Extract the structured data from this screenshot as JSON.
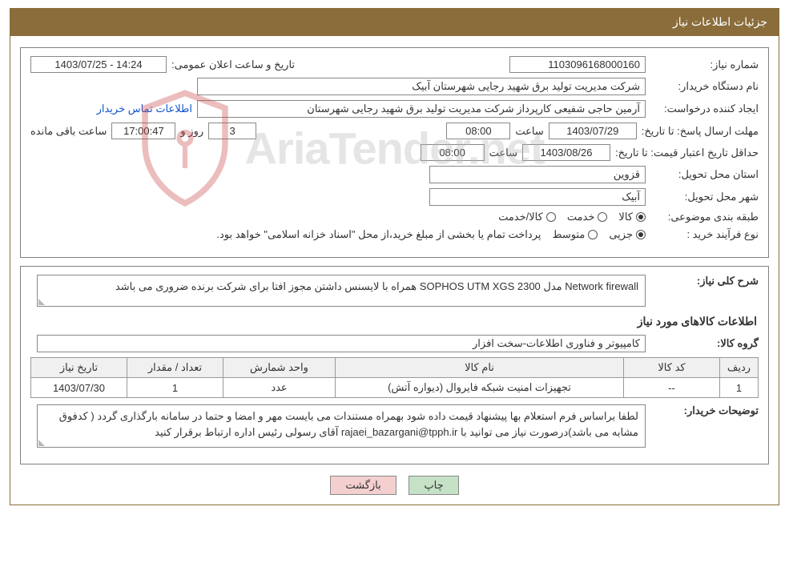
{
  "header": {
    "title": "جزئیات اطلاعات نیاز"
  },
  "labels": {
    "need_no": "شماره نیاز:",
    "announce_dt": "تاریخ و ساعت اعلان عمومی:",
    "buyer_org": "نام دستگاه خریدار:",
    "requester": "ایجاد کننده درخواست:",
    "buyer_contact": "اطلاعات تماس خریدار",
    "reply_deadline": "مهلت ارسال پاسخ:",
    "till_date": "تا تاریخ:",
    "hour": "ساعت",
    "days_and": "روز و",
    "hours_left": "ساعت باقی مانده",
    "price_validity": "حداقل تاریخ اعتبار قیمت:",
    "delivery_prov": "استان محل تحویل:",
    "delivery_city": "شهر محل تحویل:",
    "subject_class": "طبقه بندی موضوعی:",
    "goods": "کالا",
    "service": "خدمت",
    "goods_service": "کالا/خدمت",
    "buy_type": "نوع فرآیند خرید :",
    "partial": "جزیی",
    "medium": "متوسط",
    "pay_note": "پرداخت تمام یا بخشی از مبلغ خرید،از محل \"اسناد خزانه اسلامی\" خواهد بود.",
    "desc": "شرح کلی نیاز:",
    "items_title": "اطلاعات کالاهای مورد نیاز",
    "goods_group": "گروه کالا:",
    "buyer_notes": "توضیحات خریدار:"
  },
  "values": {
    "need_no": "1103096168000160",
    "announce_dt": "1403/07/25 - 14:24",
    "buyer_org": "شرکت مدیریت تولید برق شهید رجایی شهرستان آبیک",
    "requester": "آرمین حاجی شفیعی کارپرداز شرکت مدیریت تولید برق شهید رجایی شهرستان",
    "reply_date": "1403/07/29",
    "reply_hour": "08:00",
    "days_left": "3",
    "countdown": "17:00:47",
    "price_date": "1403/08/26",
    "price_hour": "08:00",
    "province": "قزوین",
    "city": "آبیک",
    "desc": "Network firewall  مدل SOPHOS UTM  XGS 2300 همراه با لایسنس داشتن مجوز افتا برای شرکت برنده ضروری می باشد",
    "goods_group": "کامپیوتر و فناوری اطلاعات-سخت افزار",
    "buyer_notes": "لطفا براساس فرم استعلام بها پیشنهاد قیمت داده شود بهمراه مستندات می بایست مهر و امضا و حتما در سامانه بارگذاری گردد ( کدفوق مشابه می باشد)درصورت نیاز می توانید با rajaei_bazargani@tpph.ir آقای رسولی رئیس  اداره ارتباط برقرار کنید"
  },
  "table": {
    "headers": {
      "row": "ردیف",
      "code": "کد کالا",
      "name": "نام کالا",
      "unit": "واحد شمارش",
      "qty": "تعداد / مقدار",
      "date": "تاریخ نیاز"
    },
    "rows": [
      {
        "row": "1",
        "code": "--",
        "name": "تجهیزات امنیت شبکه فایروال (دیواره آتش)",
        "unit": "عدد",
        "qty": "1",
        "date": "1403/07/30"
      }
    ]
  },
  "buttons": {
    "print": "چاپ",
    "back": "بازگشت"
  },
  "watermark": "AriaTender.net"
}
